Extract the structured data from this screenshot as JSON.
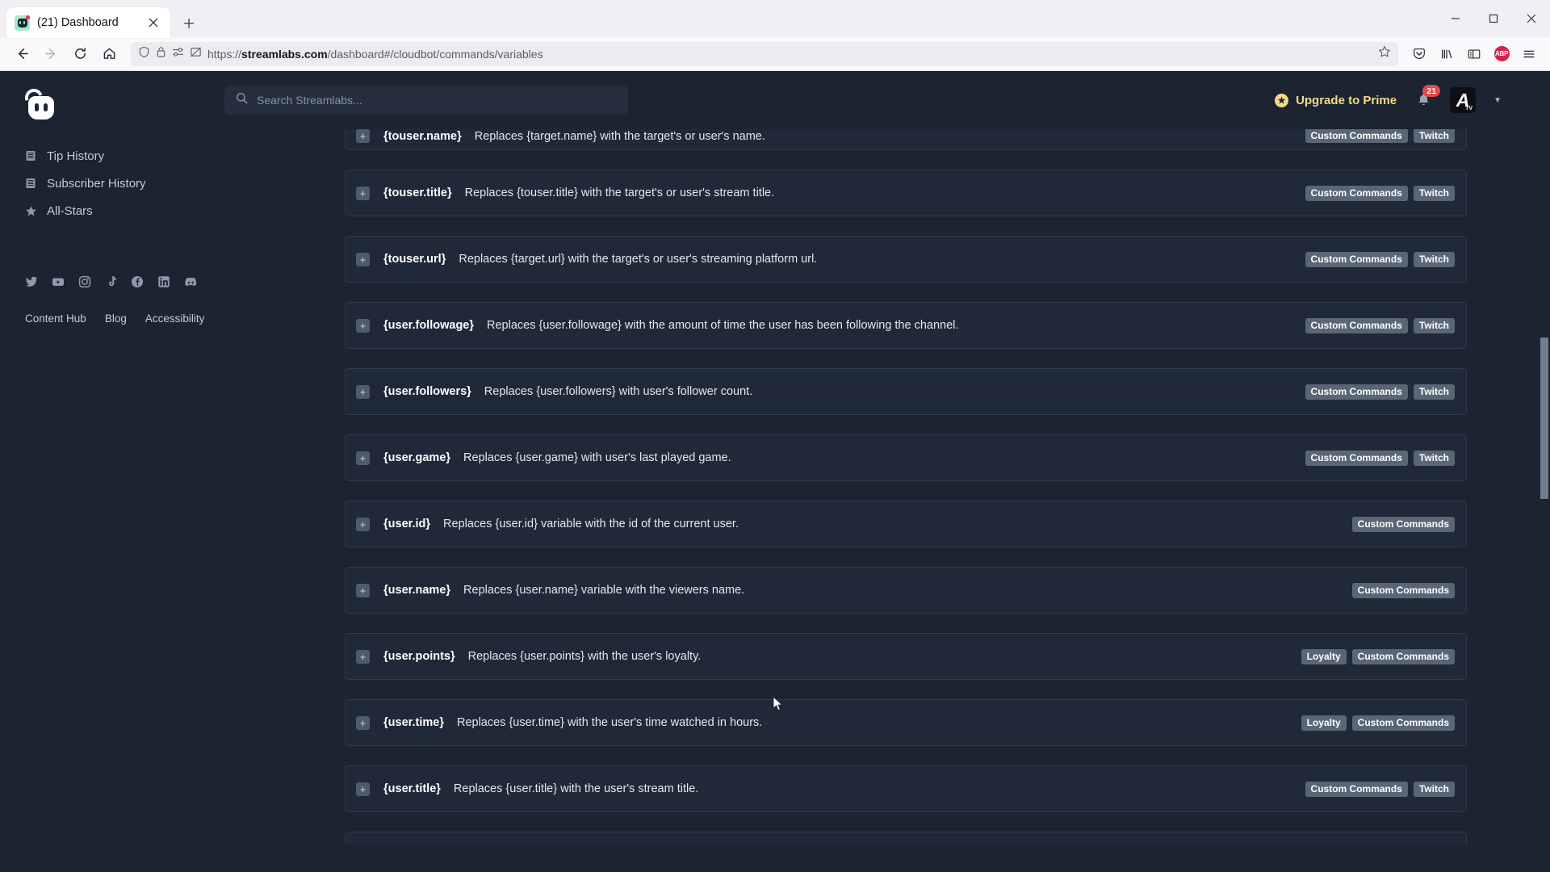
{
  "browser": {
    "tab": {
      "title": "(21) Dashboard",
      "favicon": "streamlabs-favicon",
      "close_label": "✕"
    },
    "newtab_label": "+",
    "window_controls": {
      "minimize": "—",
      "maximize": "☐",
      "close": "✕"
    },
    "nav": {
      "back": "back-arrow",
      "forward": "forward-arrow",
      "reload": "reload-arrow",
      "home": "home-icon"
    },
    "url": {
      "scheme": "https://",
      "domain": "streamlabs.com",
      "path": "/dashboard#/cloudbot/commands/variables"
    },
    "url_icons": [
      "shield-icon",
      "lock-icon",
      "permissions-icon",
      "tracking-protection-off-icon"
    ],
    "bookmark_icon": "star-outline-icon",
    "toolbar_icons": [
      "pocket-icon",
      "library-icon",
      "sidebar-icon",
      "adblock-plus-icon",
      "app-menu-icon"
    ],
    "adblock_label": "ABP"
  },
  "sidebar": {
    "logo": "streamlabs-logo",
    "items": [
      {
        "label": "Tip History",
        "icon": "list-icon"
      },
      {
        "label": "Subscriber History",
        "icon": "list-icon"
      },
      {
        "label": "All-Stars",
        "icon": "star-icon"
      }
    ],
    "socials": [
      {
        "name": "twitter-icon",
        "glyph": "twitter"
      },
      {
        "name": "youtube-icon",
        "glyph": "youtube"
      },
      {
        "name": "instagram-icon",
        "glyph": "instagram"
      },
      {
        "name": "tiktok-icon",
        "glyph": "tiktok"
      },
      {
        "name": "facebook-icon",
        "glyph": "facebook"
      },
      {
        "name": "linkedin-icon",
        "glyph": "linkedin"
      },
      {
        "name": "discord-icon",
        "glyph": "discord"
      }
    ],
    "footer_links": [
      "Content Hub",
      "Blog",
      "Accessibility"
    ]
  },
  "header": {
    "search_placeholder": "Search Streamlabs...",
    "search_value": "",
    "prime_label": "Upgrade to Prime",
    "notification_count": "21",
    "avatar_initial": "A",
    "avatar_sub": "TV"
  },
  "variables": [
    {
      "name": "{touser.name}",
      "desc": "Replaces {target.name} with the target's or user's name.",
      "tags": [
        "Custom Commands",
        "Twitch"
      ]
    },
    {
      "name": "{touser.title}",
      "desc": "Replaces {touser.title} with the target's or user's stream title.",
      "tags": [
        "Custom Commands",
        "Twitch"
      ]
    },
    {
      "name": "{touser.url}",
      "desc": "Replaces {target.url} with the target's or user's streaming platform url.",
      "tags": [
        "Custom Commands",
        "Twitch"
      ]
    },
    {
      "name": "{user.followage}",
      "desc": "Replaces {user.followage} with the amount of time the user has been following the channel.",
      "tags": [
        "Custom Commands",
        "Twitch"
      ]
    },
    {
      "name": "{user.followers}",
      "desc": "Replaces {user.followers} with user's follower count.",
      "tags": [
        "Custom Commands",
        "Twitch"
      ]
    },
    {
      "name": "{user.game}",
      "desc": "Replaces {user.game} with user's last played game.",
      "tags": [
        "Custom Commands",
        "Twitch"
      ]
    },
    {
      "name": "{user.id}",
      "desc": "Replaces {user.id} variable with the id of the current user.",
      "tags": [
        "Custom Commands"
      ]
    },
    {
      "name": "{user.name}",
      "desc": "Replaces {user.name} variable with the viewers name.",
      "tags": [
        "Custom Commands"
      ]
    },
    {
      "name": "{user.points}",
      "desc": "Replaces {user.points} with the user's loyalty.",
      "tags": [
        "Loyalty",
        "Custom Commands"
      ]
    },
    {
      "name": "{user.time}",
      "desc": "Replaces {user.time} with the user's time watched in hours.",
      "tags": [
        "Loyalty",
        "Custom Commands"
      ]
    },
    {
      "name": "{user.title}",
      "desc": "Replaces {user.title} with the user's stream title.",
      "tags": [
        "Custom Commands",
        "Twitch"
      ]
    }
  ],
  "row_expand_label": "+",
  "colors": {
    "page_bg": "#1b2430",
    "row_bg": "#1f2937",
    "row_border": "#2f3c4d",
    "tag_bg": "#596676",
    "prime_gold": "#f2d98a",
    "badge_red": "#e5484d",
    "scrollbar_thumb": "#6f7d8c"
  }
}
